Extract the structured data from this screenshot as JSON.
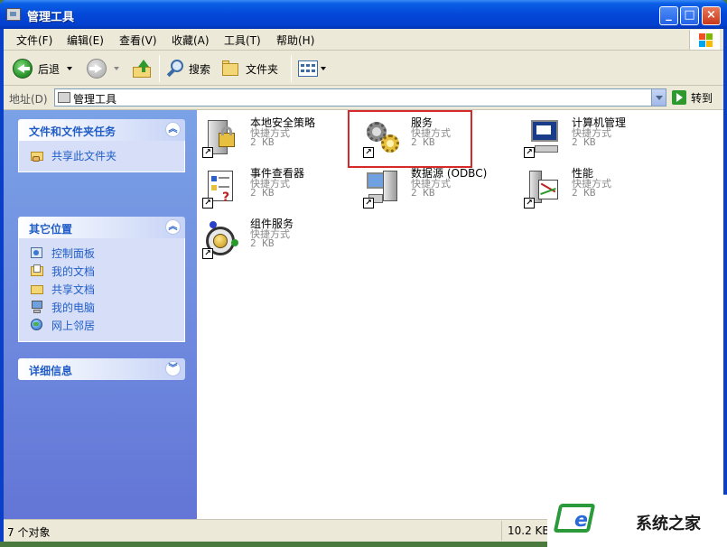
{
  "window": {
    "title": "管理工具"
  },
  "menubar": [
    "文件(F)",
    "编辑(E)",
    "查看(V)",
    "收藏(A)",
    "工具(T)",
    "帮助(H)"
  ],
  "toolbar": {
    "back": "后退",
    "search": "搜索",
    "folders": "文件夹"
  },
  "address": {
    "label": "地址(D)",
    "value": "管理工具",
    "go": "转到"
  },
  "sidebar": {
    "tasks": {
      "title": "文件和文件夹任务",
      "items": [
        "共享此文件夹"
      ]
    },
    "places": {
      "title": "其它位置",
      "items": [
        "控制面板",
        "我的文档",
        "共享文档",
        "我的电脑",
        "网上邻居"
      ]
    },
    "details": {
      "title": "详细信息"
    }
  },
  "items": [
    {
      "name": "本地安全策略",
      "type": "快捷方式",
      "size": "2 KB"
    },
    {
      "name": "服务",
      "type": "快捷方式",
      "size": "2 KB"
    },
    {
      "name": "计算机管理",
      "type": "快捷方式",
      "size": "2 KB"
    },
    {
      "name": "事件查看器",
      "type": "快捷方式",
      "size": "2 KB"
    },
    {
      "name": "数据源 (ODBC)",
      "type": "快捷方式",
      "size": "2 KB"
    },
    {
      "name": "性能",
      "type": "快捷方式",
      "size": "2 KB"
    },
    {
      "name": "组件服务",
      "type": "快捷方式",
      "size": "2 KB"
    }
  ],
  "status": {
    "count": "7 个对象",
    "size": "10.2 KB"
  },
  "watermark": "系统之家",
  "colors": {
    "highlight": "#d62a2a",
    "link": "#215dc6",
    "titlebar": "#0447d8"
  }
}
